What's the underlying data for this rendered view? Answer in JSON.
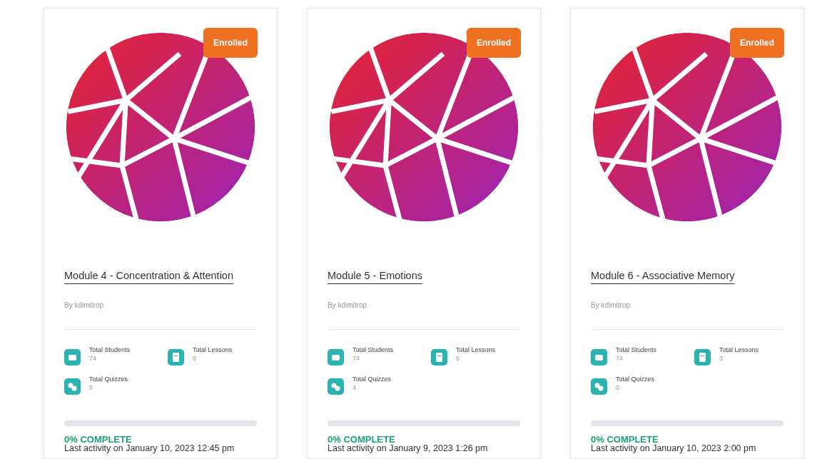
{
  "courses": [
    {
      "badge": "Enrolled",
      "title": "Module 4 - Concentration & Attention",
      "author": "By kdimitrop",
      "stats": [
        {
          "kind": "students",
          "label": "Total Students",
          "value": "74"
        },
        {
          "kind": "lessons",
          "label": "Total Lessons",
          "value": "6"
        },
        {
          "kind": "quizzes",
          "label": "Total Quizzes",
          "value": "0"
        }
      ],
      "progress": {
        "level": 0,
        "label": "0% COMPLETE"
      },
      "last_activity": "Last activity on January 10, 2023 12:45 pm"
    },
    {
      "badge": "Enrolled",
      "title": "Module 5 - Emotions",
      "author": "By kdimitrop",
      "stats": [
        {
          "kind": "students",
          "label": "Total Students",
          "value": "74"
        },
        {
          "kind": "lessons",
          "label": "Total Lessons",
          "value": "6"
        },
        {
          "kind": "quizzes",
          "label": "Total Quizzes",
          "value": "4"
        }
      ],
      "progress": {
        "level": 0,
        "label": "0% COMPLETE"
      },
      "last_activity": "Last activity on January 9, 2023 1:26 pm"
    },
    {
      "badge": "Enrolled",
      "title": "Module 6 - Associative Memory",
      "author": "By kdimitrop",
      "stats": [
        {
          "kind": "students",
          "label": "Total Students",
          "value": "74"
        },
        {
          "kind": "lessons",
          "label": "Total Lessons",
          "value": "3"
        },
        {
          "kind": "quizzes",
          "label": "Total Quizzes",
          "value": "0"
        }
      ],
      "progress": {
        "level": 0,
        "label": "0% COMPLETE"
      },
      "last_activity": "Last activity on January 10, 2023 2:00 pm"
    }
  ]
}
